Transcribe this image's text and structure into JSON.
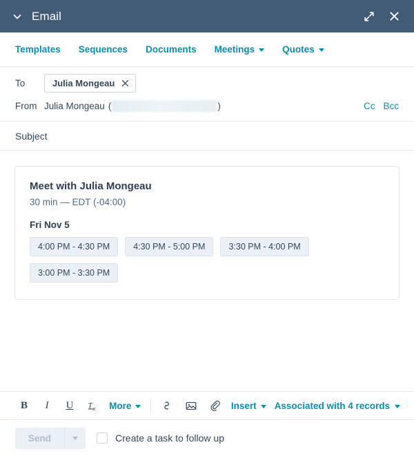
{
  "window": {
    "title": "Email",
    "collapse_icon": "chevron-down-icon",
    "expand_icon": "expand-diagonal-icon",
    "close_icon": "close-x-icon",
    "header_color": "#425b76"
  },
  "nav": {
    "items": [
      {
        "label": "Templates",
        "has_caret": false
      },
      {
        "label": "Sequences",
        "has_caret": false
      },
      {
        "label": "Documents",
        "has_caret": false
      },
      {
        "label": "Meetings",
        "has_caret": true
      },
      {
        "label": "Quotes",
        "has_caret": true
      }
    ],
    "link_color": "#0091ae"
  },
  "fields": {
    "to_label": "To",
    "to_recipients": [
      {
        "name": "Julia Mongeau",
        "remove_icon": "close-x-icon"
      }
    ],
    "from_label": "From",
    "from_name": "Julia Mongeau",
    "from_open_paren": "(",
    "from_close_paren": ")",
    "from_email_redacted": true,
    "cc_label": "Cc",
    "bcc_label": "Bcc",
    "subject_placeholder": "Subject"
  },
  "meeting_card": {
    "title": "Meet with Julia Mongeau",
    "duration_timezone": "30 min — EDT (-04:00)",
    "day_label": "Fri Nov 5",
    "slots": [
      "4:00 PM - 4:30 PM",
      "4:30 PM - 5:00 PM",
      "3:30 PM - 4:00 PM",
      "3:00 PM - 3:30 PM"
    ],
    "slot_bg": "#eaf0f6"
  },
  "toolbar": {
    "bold": "B",
    "italic": "I",
    "underline": "U",
    "clear_format": "Tx",
    "more_label": "More",
    "link_icon": "link-chain-icon",
    "image_icon": "image-icon",
    "attachment_icon": "paperclip-icon",
    "insert_label": "Insert",
    "associated_label": "Associated with 4 records"
  },
  "sendbar": {
    "send_label": "Send",
    "send_disabled": true,
    "send_caret_icon": "caret-down-icon",
    "task_checkbox_checked": false,
    "task_label": "Create a task to follow up"
  }
}
